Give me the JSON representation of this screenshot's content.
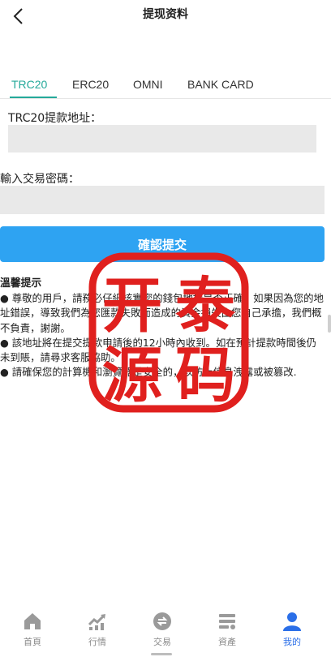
{
  "header": {
    "title": "提现资料",
    "back_icon": "chevron-left-icon"
  },
  "tabs": [
    {
      "label": "TRC20",
      "active": true
    },
    {
      "label": "ERC20",
      "active": false
    },
    {
      "label": "OMNI",
      "active": false
    },
    {
      "label": "BANK CARD",
      "active": false
    }
  ],
  "form": {
    "address_label": "TRC20提款地址：",
    "address_value": "",
    "password_label": "輸入交易密碼：",
    "password_value": "",
    "submit_label": "確認提交"
  },
  "notice": {
    "title": "溫馨提示",
    "items": [
      "● 尊敬的用戶，請務必仔細核實您的錢包地址是否正確。如果因為您的地址錯誤，導致我們為您匯款失敗而造成的資金損失由您自己承擔，我們概不負責，謝謝。",
      "● 該地址將在提交提款申請後的12小時內收到。如在預計提款時間後仍未到賬，請尋求客服協助。",
      "● 請確保您的計算機和瀏覽器是安全的，以防止信息洩露或被篡改."
    ]
  },
  "watermark": {
    "chars": [
      "开",
      "泰",
      "源",
      "码"
    ],
    "color": "#e0201e"
  },
  "tabbar": [
    {
      "label": "首頁",
      "icon": "home-icon",
      "active": false
    },
    {
      "label": "行情",
      "icon": "market-chart-icon",
      "active": false
    },
    {
      "label": "交易",
      "icon": "exchange-icon",
      "active": false
    },
    {
      "label": "資產",
      "icon": "assets-icon",
      "active": false
    },
    {
      "label": "我的",
      "icon": "user-icon",
      "active": true
    }
  ],
  "colors": {
    "accent_tab": "#25a99a",
    "button": "#2ea3f2",
    "active_nav": "#2b6fe8",
    "inactive_icon": "#9a9a9a"
  }
}
